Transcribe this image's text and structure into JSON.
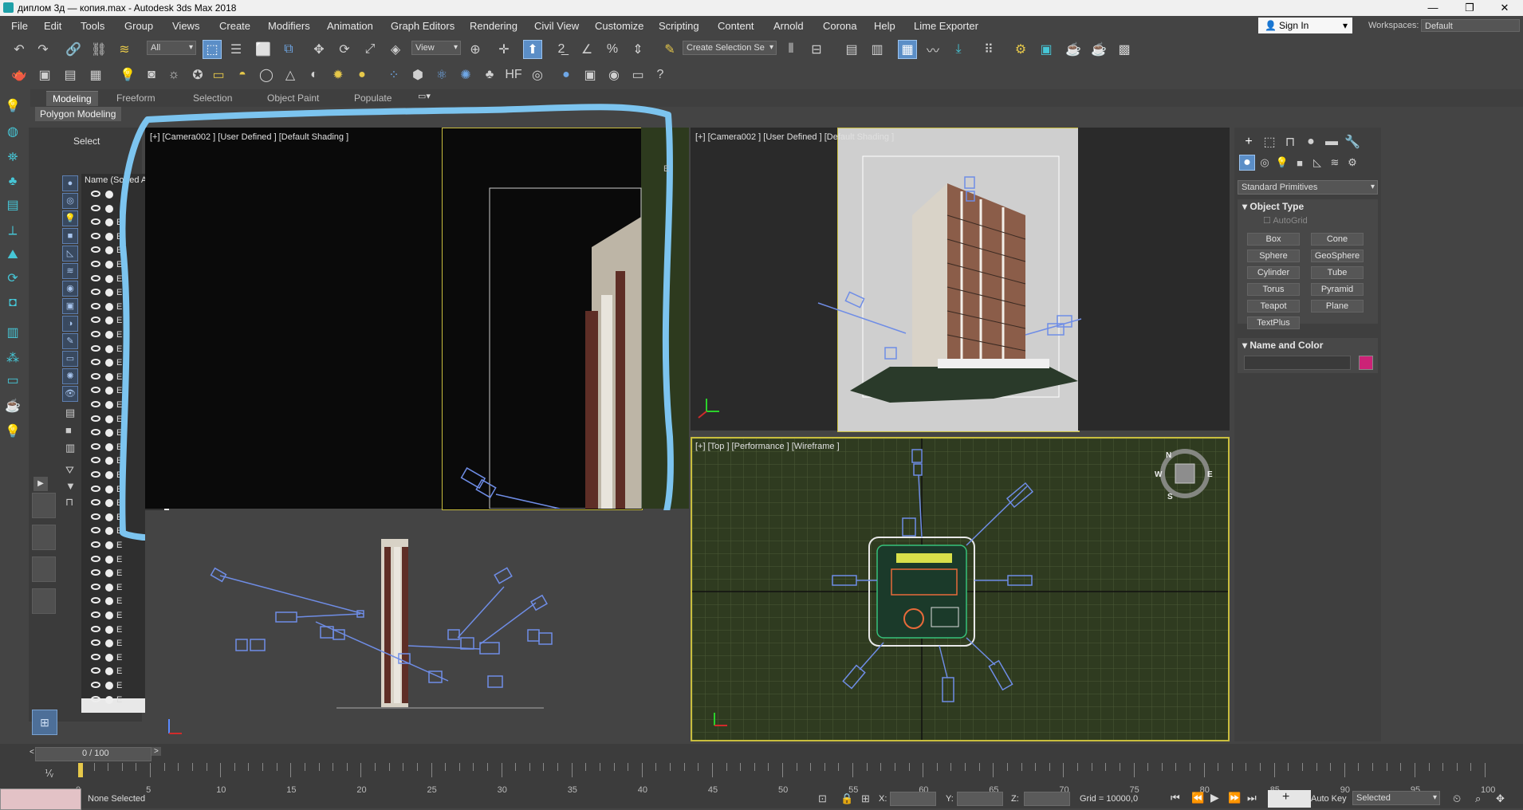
{
  "window": {
    "title": "диплом 3д — копия.max - Autodesk 3ds Max 2018",
    "minimize": "—",
    "restore": "❐",
    "close": "✕"
  },
  "menu": {
    "items": [
      "File",
      "Edit",
      "Tools",
      "Group",
      "Views",
      "Create",
      "Modifiers",
      "Animation",
      "Graph Editors",
      "Rendering",
      "Civil View",
      "Customize",
      "Scripting",
      "Content",
      "Arnold",
      "Corona",
      "Help",
      "Lime Exporter"
    ],
    "sign_in": "Sign In",
    "workspaces_label": "Workspaces:",
    "workspace": "Default"
  },
  "toolbar": {
    "filter": "All",
    "view": "View",
    "selection_set": "Create Selection Se"
  },
  "ribbon": {
    "tabs": [
      "Modeling",
      "Freeform",
      "Selection",
      "Object Paint",
      "Populate"
    ],
    "active_tab": "Modeling",
    "sub": "Polygon Modeling"
  },
  "explorer": {
    "select": "Select",
    "column_header": "Name (Sorted A",
    "row_prefix": "E"
  },
  "viewports": {
    "top_left": "[+] [Camera002 ] [User Defined ] [Default Shading ]",
    "top_right": "[+] [Camera002 ] [User Defined ] [Default Shading ]",
    "bottom_right": "[+] [Top ] [Performance ] [Wireframe ]",
    "compass": {
      "n": "N",
      "s": "S",
      "e": "E",
      "w": "W"
    }
  },
  "command_panel": {
    "category": "Standard Primitives",
    "object_type_title": "Object Type",
    "autogrid": "AutoGrid",
    "buttons": [
      "Box",
      "Cone",
      "Sphere",
      "GeoSphere",
      "Cylinder",
      "Tube",
      "Torus",
      "Pyramid",
      "Teapot",
      "Plane",
      "TextPlus"
    ],
    "name_color_title": "Name and Color",
    "object_color": "#cc2277"
  },
  "timeline": {
    "frame_counter": "0 / 100",
    "ticks": [
      "0",
      "5",
      "10",
      "15",
      "20",
      "25",
      "30",
      "35",
      "40",
      "45",
      "50",
      "55",
      "60",
      "65",
      "70",
      "75",
      "80",
      "85",
      "90",
      "95",
      "100"
    ]
  },
  "status": {
    "selection": "None Selected",
    "x_label": "X:",
    "y_label": "Y:",
    "z_label": "Z:",
    "grid": "Grid = 10000,0",
    "auto_key": "Auto Key",
    "key_mode": "Selected"
  }
}
